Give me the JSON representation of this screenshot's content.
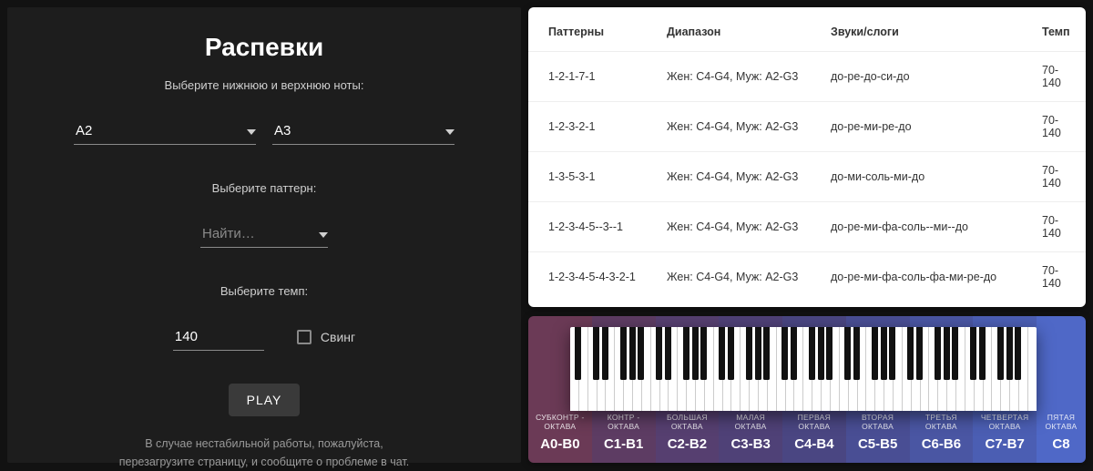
{
  "left": {
    "title": "Распевки",
    "notesLabel": "Выберите нижнюю и верхнюю ноты:",
    "lowNote": "A2",
    "highNote": "A3",
    "patternLabel": "Выберите паттерн:",
    "patternPlaceholder": "Найти…",
    "tempoLabel": "Выберите темп:",
    "tempoValue": "140",
    "swingLabel": "Свинг",
    "playLabel": "PLAY",
    "footer1": "В случае нестабильной работы, пожалуйста,",
    "footer2": "перезагрузите страницу, и сообщите о проблеме в чат."
  },
  "table": {
    "headers": [
      "Паттерны",
      "Диапазон",
      "Звуки/слоги",
      "Темп"
    ],
    "rows": [
      {
        "pattern": "1-2-1-7-1",
        "range": "Жен: C4-G4, Муж: A2-G3",
        "sounds": "до-ре-до-си-до",
        "tempo": "70-140"
      },
      {
        "pattern": "1-2-3-2-1",
        "range": "Жен: C4-G4, Муж: A2-G3",
        "sounds": "до-ре-ми-ре-до",
        "tempo": "70-140"
      },
      {
        "pattern": "1-3-5-3-1",
        "range": "Жен: C4-G4, Муж: A2-G3",
        "sounds": "до-ми-соль-ми-до",
        "tempo": "70-140"
      },
      {
        "pattern": "1-2-3-4-5--3--1",
        "range": "Жен: C4-G4, Муж: A2-G3",
        "sounds": "до-ре-ми-фа-соль--ми--до",
        "tempo": "70-140"
      },
      {
        "pattern": "1-2-3-4-5-4-3-2-1",
        "range": "Жен: C4-G4, Муж: A2-G3",
        "sounds": "до-ре-ми-фа-соль-фа-ми-ре-до",
        "tempo": "70-140"
      }
    ]
  },
  "octaves": [
    {
      "name": "СУБКОНТР -\nОКТАВА",
      "range": "A0-B0",
      "color": "#6b3a56"
    },
    {
      "name": "КОНТР -\nОКТАВА",
      "range": "C1-B1",
      "color": "#5d3c63"
    },
    {
      "name": "БОЛЬШАЯ\nОКТАВА",
      "range": "C2-B2",
      "color": "#563f70"
    },
    {
      "name": "МАЛАЯ\nОКТАВА",
      "range": "C3-B3",
      "color": "#4f4177"
    },
    {
      "name": "ПЕРВАЯ\nОКТАВА",
      "range": "C4-B4",
      "color": "#4a4682"
    },
    {
      "name": "ВТОРАЯ\nОКТАВА",
      "range": "C5-B5",
      "color": "#494e94"
    },
    {
      "name": "ТРЕТЬЯ\nОКТАВА",
      "range": "C6-B6",
      "color": "#4a56a3"
    },
    {
      "name": "ЧЕТВЕРТАЯ\nОКТАВА",
      "range": "C7-B7",
      "color": "#4b5eb3"
    },
    {
      "name": "ПЯТАЯ\nОКТАВА",
      "range": "C8",
      "color": "#4f68c7",
      "last": true
    }
  ]
}
